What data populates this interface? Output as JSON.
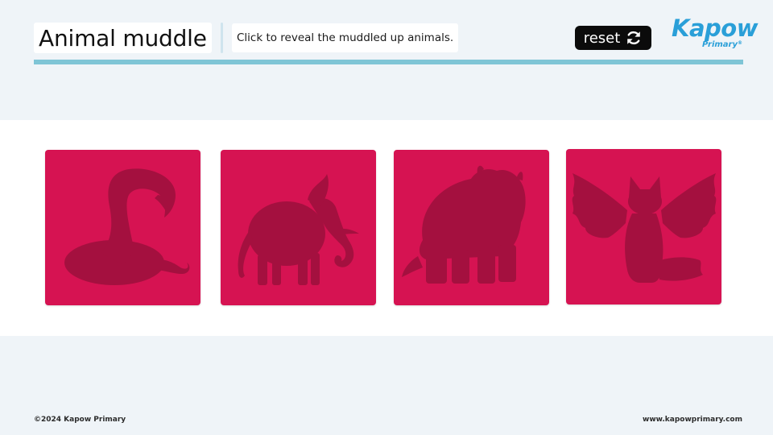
{
  "header": {
    "title": "Animal muddle",
    "instruction": "Click to reveal the muddled up animals.",
    "reset_label": "reset",
    "reset_icon": "refresh-icon"
  },
  "logo": {
    "word": "Kapow",
    "sub": "Primary",
    "mark": "®",
    "color": "#2a9fd8"
  },
  "cards": [
    {
      "silhouette": "snake-silhouette",
      "icon": "snake-icon"
    },
    {
      "silhouette": "elephant-silhouette",
      "icon": "elephant-icon"
    },
    {
      "silhouette": "hippo-silhouette",
      "icon": "hippo-icon"
    },
    {
      "silhouette": "winged-fox-silhouette",
      "icon": "winged-fox-icon"
    }
  ],
  "colors": {
    "card": "#d61352",
    "silhouette": "#a4103f",
    "accent_rule": "#7fc5d6",
    "page_background": "#eff4f8"
  },
  "footer": {
    "copyright": "©2024 Kapow Primary",
    "website": "www.kapowprimary.com"
  }
}
